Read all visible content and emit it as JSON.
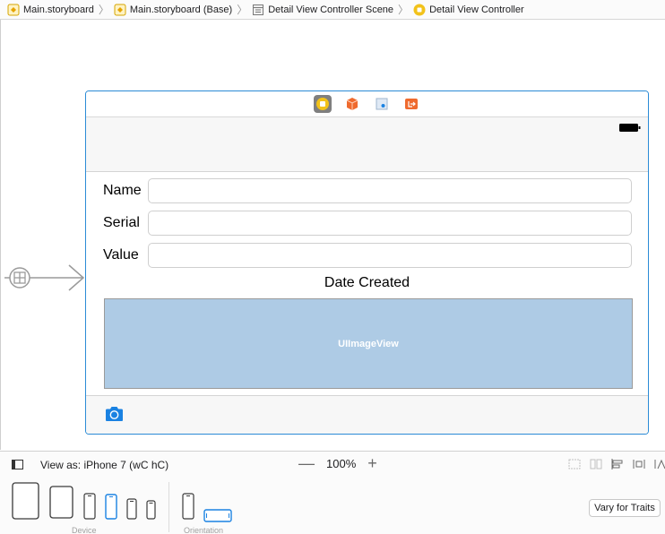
{
  "breadcrumb": {
    "items": [
      {
        "label": "Main.storyboard",
        "icon": "storyboard-icon"
      },
      {
        "label": "Main.storyboard (Base)",
        "icon": "storyboard-icon"
      },
      {
        "label": "Detail View Controller Scene",
        "icon": "scene-icon"
      },
      {
        "label": "Detail View Controller",
        "icon": "view-controller-icon"
      }
    ]
  },
  "scene": {
    "fields": [
      {
        "label": "Name",
        "value": ""
      },
      {
        "label": "Serial",
        "value": ""
      },
      {
        "label": "Value",
        "value": ""
      }
    ],
    "date_label": "Date Created",
    "image_view_label": "UIImageView"
  },
  "bottom_bar": {
    "view_as": "View as: iPhone 7 (wC hC)",
    "zoom_minus": "—",
    "zoom_level": "100%",
    "zoom_plus": "+",
    "device_caption": "Device",
    "orientation_caption": "Orientation",
    "vary_button": "Vary for Traits"
  },
  "colors": {
    "accent": "#1a82e2",
    "scene_border": "#2b8bd6",
    "image_view_fill": "#aecbe5",
    "view_controller_icon": "#f2c21a",
    "dock_orange": "#ef6a2e"
  }
}
